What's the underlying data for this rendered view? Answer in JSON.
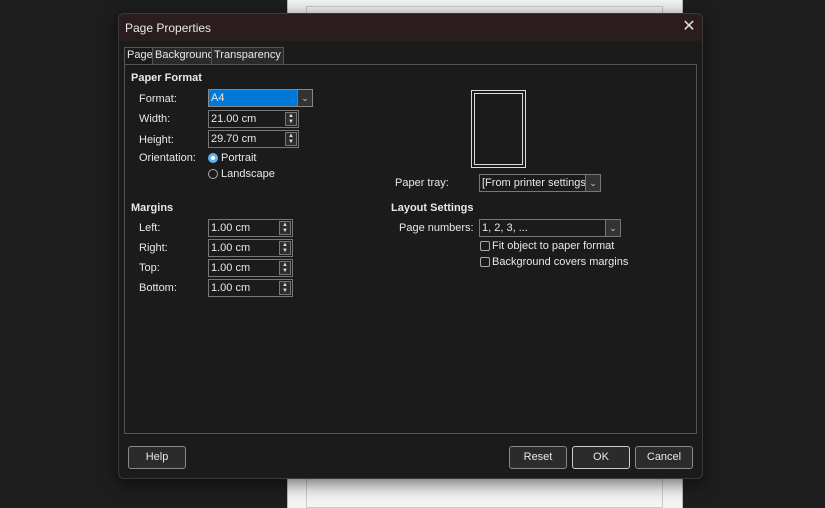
{
  "dialog": {
    "title": "Page Properties",
    "close_icon": "close-icon"
  },
  "tabs": [
    {
      "label": "Page",
      "active": true
    },
    {
      "label": "Background"
    },
    {
      "label": "Transparency"
    }
  ],
  "paper_format": {
    "heading": "Paper Format",
    "format_label": "Format:",
    "format_value": "A4",
    "width_label": "Width:",
    "width_value": "21.00 cm",
    "height_label": "Height:",
    "height_value": "29.70 cm",
    "orientation_label": "Orientation:",
    "portrait": "Portrait",
    "landscape": "Landscape",
    "selected": "Portrait"
  },
  "paper_tray": {
    "label": "Paper tray:",
    "value": "[From printer settings]"
  },
  "margins": {
    "heading": "Margins",
    "left_label": "Left:",
    "left": "1.00 cm",
    "right_label": "Right:",
    "right": "1.00 cm",
    "top_label": "Top:",
    "top": "1.00 cm",
    "bottom_label": "Bottom:",
    "bottom": "1.00 cm"
  },
  "layout": {
    "heading": "Layout Settings",
    "page_numbers_label": "Page numbers:",
    "page_numbers_value": "1, 2, 3, ...",
    "fit_object": "Fit object to paper format",
    "fit_checked": false,
    "bg_covers": "Background covers margins",
    "bg_checked": false
  },
  "buttons": {
    "help": "Help",
    "reset": "Reset",
    "ok": "OK",
    "cancel": "Cancel"
  },
  "colors": {
    "accent": "#0078d7",
    "radio": "#5fb4f0"
  }
}
